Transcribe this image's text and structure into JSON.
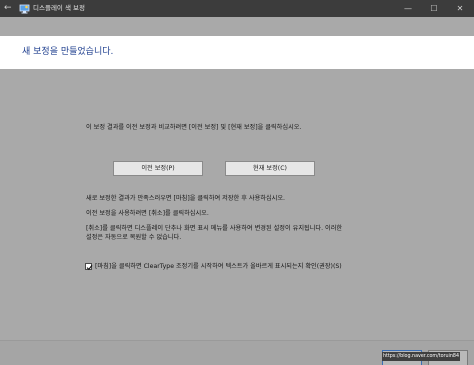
{
  "window": {
    "title": "디스플레이 색 보정",
    "back_glyph": "←",
    "minimize_glyph": "—",
    "maximize_glyph": "☐",
    "close_glyph": "✕",
    "app_icon": "display-calibration-icon"
  },
  "header": {
    "title": "새 보정을 만들었습니다."
  },
  "main": {
    "compare_instruction": "이 보정 결과를 이전 보정과 비교하려면 [이전 보정] 및 [현재 보정]을 클릭하십시오.",
    "previous_button": "이전 보정(P)",
    "current_button": "현재 보정(C)",
    "info_line1": "새로 보정한 결과가 만족스러우면 [마침]을 클릭하여 저장한 후 사용하십시오.",
    "info_line2": "이전 보정을 사용하려면 [취소]를 클릭하십시오.",
    "info_line3a": "[취소]를 클릭하면 디스플레이 단추나 화면 표시 메뉴를 사용하여 변경된 설정이 유지됩니다. 이러한",
    "info_line3b": "설정은 자동으로 복원할 수 없습니다.",
    "cleartype_label": "[마침]을 클릭하면 ClearType 조정기를 시작하여 텍스트가 올바르게 표시되는지 확인(권장)(S)",
    "cleartype_checked": true
  },
  "footer": {
    "finish_label": "",
    "cancel_label": ""
  },
  "watermark": "https://blog.naver.com/toruin84",
  "colors": {
    "titlebar": "#3c3c3c",
    "header_title": "#1f3f8f",
    "content_bg": "#a9a9a9"
  }
}
